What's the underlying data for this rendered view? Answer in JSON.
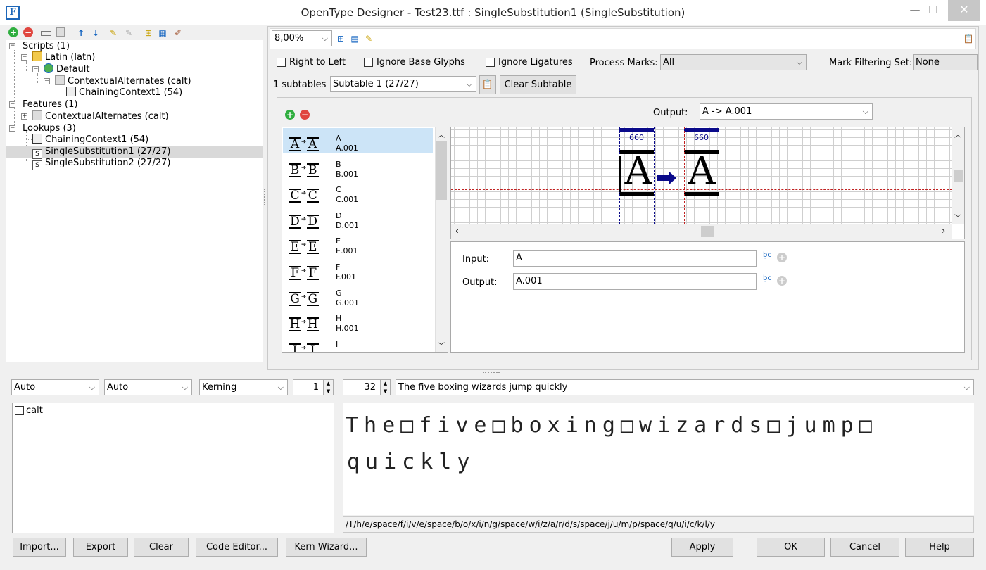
{
  "window": {
    "title": "OpenType Designer - Test23.ttf : SingleSubstitution1 (SingleSubstitution)",
    "app_icon_text": "F",
    "minimize": "—",
    "maximize": "☐",
    "close": "✕"
  },
  "tree": {
    "items": [
      {
        "label": "Scripts (1)"
      },
      {
        "label": "Latin (latn)"
      },
      {
        "label": "Default"
      },
      {
        "label": "ContextualAlternates (calt)"
      },
      {
        "label": "ChainingContext1 (54)"
      },
      {
        "label": "Features (1)"
      },
      {
        "label": "ContextualAlternates (calt)"
      },
      {
        "label": "Lookups (3)"
      },
      {
        "label": "ChainingContext1 (54)"
      },
      {
        "label": "SingleSubstitution1 (27/27)"
      },
      {
        "label": "SingleSubstitution2 (27/27)"
      }
    ]
  },
  "right_toolbar": {
    "zoom": "8,00%"
  },
  "options": {
    "right_to_left": "Right to Left",
    "ignore_base_glyphs": "Ignore Base Glyphs",
    "ignore_ligatures": "Ignore Ligatures",
    "process_marks_label": "Process Marks:",
    "process_marks_value": "All",
    "mark_filtering_label": "Mark Filtering Set:",
    "mark_filtering_value": "None"
  },
  "subtables": {
    "count_label": "1 subtables",
    "selected": "Subtable 1 (27/27)",
    "clear_button": "Clear Subtable"
  },
  "editor": {
    "output_label": "Output:",
    "output_value": "A -> A.001",
    "glyphs": [
      {
        "glyph": "A",
        "name": "A",
        "alt": "A.001"
      },
      {
        "glyph": "B",
        "name": "B",
        "alt": "B.001"
      },
      {
        "glyph": "C",
        "name": "C",
        "alt": "C.001"
      },
      {
        "glyph": "D",
        "name": "D",
        "alt": "D.001"
      },
      {
        "glyph": "E",
        "name": "E",
        "alt": "E.001"
      },
      {
        "glyph": "F",
        "name": "F",
        "alt": "F.001"
      },
      {
        "glyph": "G",
        "name": "G",
        "alt": "G.001"
      },
      {
        "glyph": "H",
        "name": "H",
        "alt": "H.001"
      },
      {
        "glyph": "I",
        "name": "I",
        "alt": ""
      }
    ],
    "preview": {
      "left_width": "660",
      "right_width": "660",
      "left_glyph": "A",
      "right_glyph": "A"
    },
    "input_label": "Input:",
    "input_value": "A",
    "output_field_label": "Output:",
    "output_field_value": "A.001"
  },
  "bottom": {
    "combo1": "Auto",
    "combo2": "Auto",
    "combo3": "Kerning",
    "spin1": "1",
    "spin2": "32",
    "sample_text": "The five boxing wizards jump quickly",
    "feature_item": "calt",
    "preview_line1": "The□five□boxing□wizards□jump□",
    "preview_line2": "quickly",
    "glyph_path": "/T/h/e/space/f/i/v/e/space/b/o/x/i/n/g/space/w/i/z/a/r/d/s/space/j/u/m/p/space/q/u/i/c/k/l/y"
  },
  "buttons": {
    "import": "Import...",
    "export": "Export",
    "clear": "Clear",
    "code_editor": "Code Editor...",
    "kern_wizard": "Kern Wizard...",
    "apply": "Apply",
    "ok": "OK",
    "cancel": "Cancel",
    "help": "Help"
  }
}
